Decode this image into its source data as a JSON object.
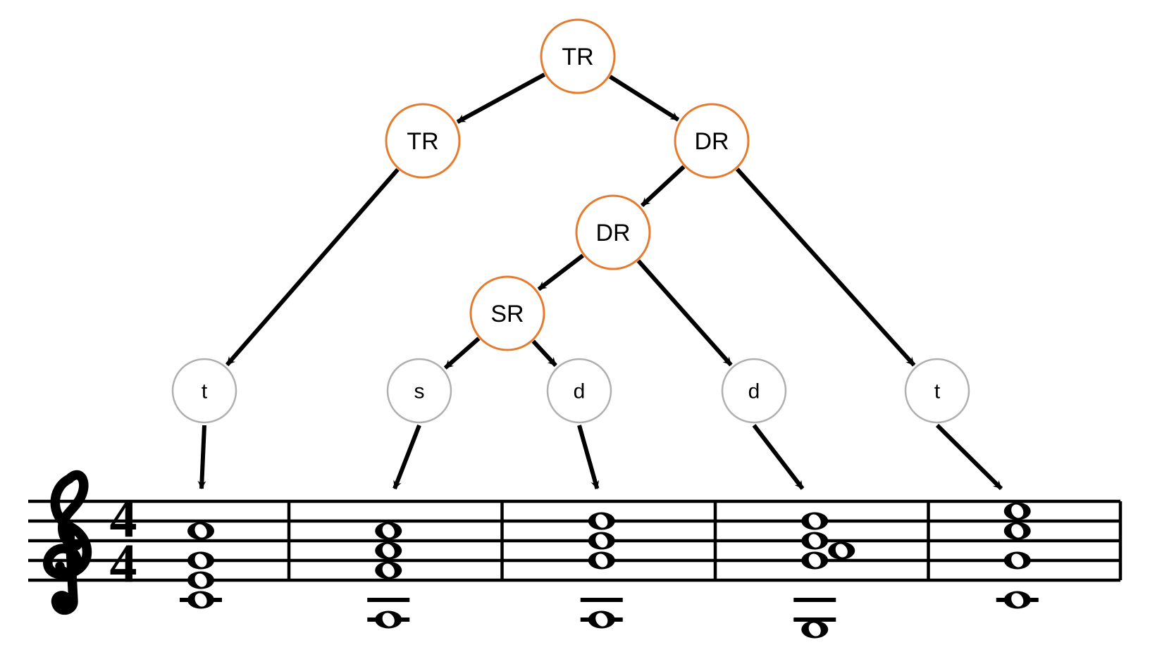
{
  "tree": {
    "nodes": {
      "root": {
        "label": "TR",
        "type": "region"
      },
      "l1a": {
        "label": "TR",
        "type": "region"
      },
      "l1b": {
        "label": "DR",
        "type": "region"
      },
      "l2dr": {
        "label": "DR",
        "type": "region"
      },
      "l3sr": {
        "label": "SR",
        "type": "region"
      },
      "leaf1": {
        "label": "t",
        "type": "function"
      },
      "leaf2": {
        "label": "s",
        "type": "function"
      },
      "leaf3": {
        "label": "d",
        "type": "function"
      },
      "leaf4": {
        "label": "d",
        "type": "function"
      },
      "leaf5": {
        "label": "t",
        "type": "function"
      }
    },
    "edges": [
      [
        "root",
        "l1a"
      ],
      [
        "root",
        "l1b"
      ],
      [
        "l1a",
        "leaf1"
      ],
      [
        "l1b",
        "l2dr"
      ],
      [
        "l1b",
        "leaf5"
      ],
      [
        "l2dr",
        "l3sr"
      ],
      [
        "l2dr",
        "leaf4"
      ],
      [
        "l3sr",
        "leaf2"
      ],
      [
        "l3sr",
        "leaf3"
      ]
    ],
    "leaf_to_chord": {
      "leaf1": 0,
      "leaf2": 1,
      "leaf3": 2,
      "leaf4": 3,
      "leaf5": 4
    }
  },
  "colors": {
    "region_stroke": "#e67b2e",
    "function_stroke": "#b0b0b0",
    "arrow": "#000000",
    "staff": "#000000"
  },
  "score": {
    "clef": "treble",
    "time_signature": "4/4",
    "chords": [
      {
        "function": "t",
        "notes": [
          "C4",
          "E4",
          "G4",
          "C5"
        ]
      },
      {
        "function": "s",
        "notes": [
          "A3",
          "F4",
          "A4",
          "C5"
        ]
      },
      {
        "function": "d",
        "notes": [
          "A3",
          "G4",
          "B4",
          "D5"
        ]
      },
      {
        "function": "d",
        "notes": [
          "G3",
          "G4",
          "B4",
          "D5"
        ],
        "passing_note": "A4"
      },
      {
        "function": "t",
        "notes": [
          "C4",
          "G4",
          "C5",
          "E5"
        ]
      }
    ]
  }
}
